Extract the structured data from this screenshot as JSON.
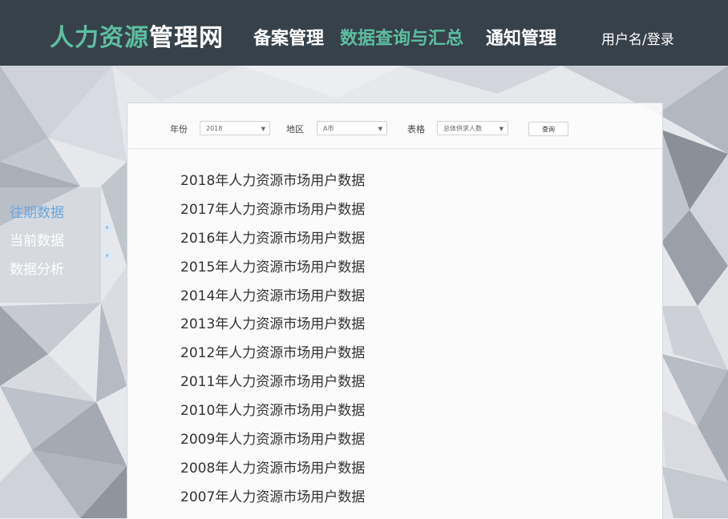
{
  "header": {
    "logo_part1": "人力资源",
    "logo_part2": "管理网",
    "nav": [
      {
        "label": "备案管理",
        "active": false
      },
      {
        "label": "数据查询与汇总",
        "active": true
      },
      {
        "label": "通知管理",
        "active": false
      }
    ],
    "user_link": "用户名/登录"
  },
  "sidebar": {
    "items": [
      {
        "label": "往期数据",
        "active": true
      },
      {
        "label": "当前数据",
        "active": false
      },
      {
        "label": "数据分析",
        "active": false
      }
    ]
  },
  "filters": {
    "year_label": "年份",
    "year_value": "2018",
    "region_label": "地区",
    "region_value": "A市",
    "table_label": "表格",
    "table_value": "总体供求人数",
    "query_button": "查询"
  },
  "reports": [
    "2018年人力资源市场用户数据",
    "2017年人力资源市场用户数据",
    "2016年人力资源市场用户数据",
    "2015年人力资源市场用户数据",
    "2014年人力资源市场用户数据",
    "2013年人力资源市场用户数据",
    "2012年人力资源市场用户数据",
    "2011年人力资源市场用户数据",
    "2010年人力资源市场用户数据",
    "2009年人力资源市场用户数据",
    "2008年人力资源市场用户数据",
    "2007年人力资源市场用户数据"
  ],
  "colors": {
    "header_bg": "#37414a",
    "accent_green": "#5cbfa0",
    "sidebar_active": "#6aa7dd"
  }
}
